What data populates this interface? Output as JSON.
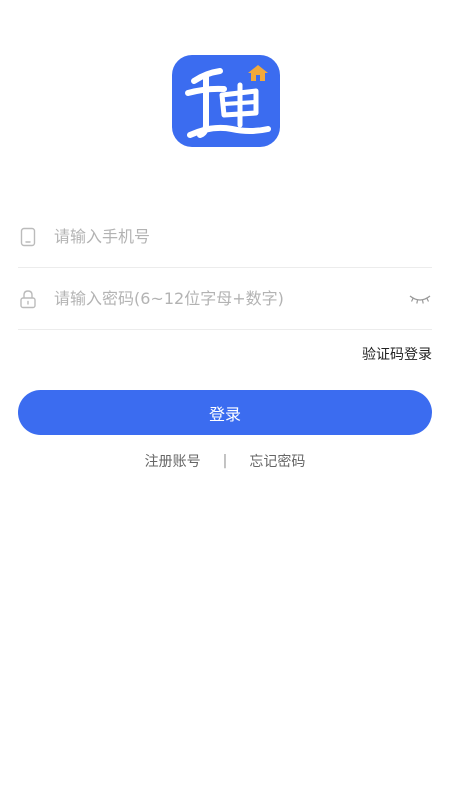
{
  "login": {
    "phone_placeholder": "请输入手机号",
    "password_placeholder": "请输入密码(6~12位字母+数字)",
    "sms_login_label": "验证码登录",
    "login_button_label": "登录",
    "register_label": "注册账号",
    "separator": "|",
    "forgot_password_label": "忘记密码"
  },
  "colors": {
    "brand": "#3b6cf0",
    "logo_house": "#f2a93b"
  },
  "icons": {
    "phone": "phone-icon",
    "lock": "lock-icon",
    "eye": "eye-closed-icon",
    "logo": "app-logo"
  }
}
